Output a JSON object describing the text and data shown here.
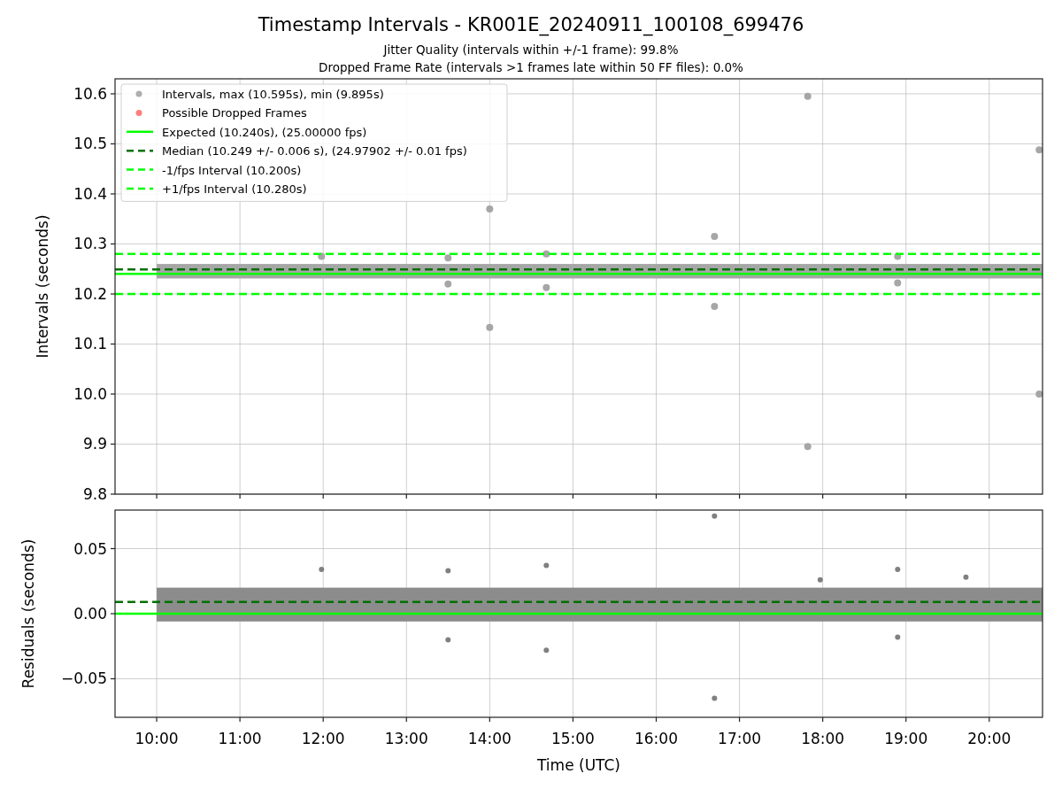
{
  "figure": {
    "title": "Timestamp Intervals - KR001E_20240911_100108_699476",
    "subtitles": [
      "Jitter Quality (intervals within +/-1 frame): 99.8%",
      "Dropped Frame Rate (intervals >1 frames late within 50 FF files): 0.0%"
    ],
    "charts": [
      {
        "chart_data": {
          "type": "scatter",
          "ylabel": "Intervals (seconds)",
          "xlim": [
            9.5,
            20.64
          ],
          "ylim": [
            9.8,
            10.63
          ],
          "grid": true,
          "legend": true,
          "bands": [
            {
              "axis": "y",
              "from": 10.231,
              "to": 10.26,
              "color": "#a6a6a6"
            }
          ],
          "yticks": [
            {
              "value": 9.8,
              "label": "9.8"
            },
            {
              "value": 9.9,
              "label": "9.9"
            },
            {
              "value": 10.0,
              "label": "10.0"
            },
            {
              "value": 10.1,
              "label": "10.1"
            },
            {
              "value": 10.2,
              "label": "10.2"
            },
            {
              "value": 10.3,
              "label": "10.3"
            },
            {
              "value": 10.4,
              "label": "10.4"
            },
            {
              "value": 10.5,
              "label": "10.5"
            },
            {
              "value": 10.6,
              "label": "10.6"
            }
          ],
          "series": [
            {
              "name": "Intervals, max (10.595s), min (9.895s)",
              "color": "#a6a6a6",
              "x": [
                11.98,
                13.5,
                13.5,
                14.0,
                14.0,
                14.68,
                14.68,
                16.7,
                16.7,
                17.82,
                17.82,
                18.9,
                18.9,
                20.6,
                20.6
              ],
              "values": [
                10.275,
                10.272,
                10.22,
                10.37,
                10.133,
                10.28,
                10.213,
                10.315,
                10.175,
                10.595,
                9.895,
                10.275,
                10.222,
                10.488,
                10.0
              ]
            },
            {
              "name": "Possible Dropped Frames",
              "color": "#ff7070"
            }
          ],
          "ref_lines": [
            {
              "axis": "y",
              "value": 10.24,
              "label": "Expected (10.240s), (25.00000 fps)",
              "color": "#00ff00"
            },
            {
              "axis": "y",
              "value": 10.249,
              "label": "Median (10.249 +/- 0.006 s), (24.97902 +/- 0.01 fps)",
              "color": "#007000"
            },
            {
              "axis": "y",
              "value": 10.2,
              "label": "-1/fps Interval (10.200s)",
              "color": "#00ff00"
            },
            {
              "axis": "y",
              "value": 10.28,
              "label": "+1/fps Interval (10.280s)",
              "color": "#00ff00"
            }
          ]
        }
      },
      {
        "chart_data": {
          "type": "scatter",
          "xlabel": "Time (UTC)",
          "ylabel": "Residuals (seconds)",
          "xlim": [
            9.5,
            20.64
          ],
          "ylim": [
            -0.0796,
            0.0796
          ],
          "grid": true,
          "bands": [
            {
              "axis": "y",
              "from": -0.006,
              "to": 0.02,
              "color": "#8c8c8c"
            }
          ],
          "xticks": [
            {
              "value": 10,
              "label": "10:00"
            },
            {
              "value": 11,
              "label": "11:00"
            },
            {
              "value": 12,
              "label": "12:00"
            },
            {
              "value": 13,
              "label": "13:00"
            },
            {
              "value": 14,
              "label": "14:00"
            },
            {
              "value": 15,
              "label": "15:00"
            },
            {
              "value": 16,
              "label": "16:00"
            },
            {
              "value": 17,
              "label": "17:00"
            },
            {
              "value": 18,
              "label": "18:00"
            },
            {
              "value": 19,
              "label": "19:00"
            },
            {
              "value": 20,
              "label": "20:00"
            }
          ],
          "yticks": [
            {
              "value": -0.05,
              "label": "−0.05"
            },
            {
              "value": 0,
              "label": "0.00"
            },
            {
              "value": 0.05,
              "label": "0.05"
            }
          ],
          "series": [
            {
              "color": "#808080",
              "x": [
                11.98,
                13.5,
                13.5,
                14.68,
                14.68,
                16.7,
                16.7,
                18.9,
                18.9,
                19.72,
                17.97
              ],
              "values": [
                0.034,
                0.033,
                -0.02,
                0.037,
                -0.028,
                0.075,
                -0.065,
                0.034,
                -0.018,
                0.028,
                0.026
              ]
            }
          ],
          "ref_lines": [
            {
              "axis": "y",
              "value": 0,
              "color": "#00ff00"
            },
            {
              "axis": "y",
              "value": 0.009,
              "color": "#007000"
            }
          ]
        }
      }
    ]
  }
}
